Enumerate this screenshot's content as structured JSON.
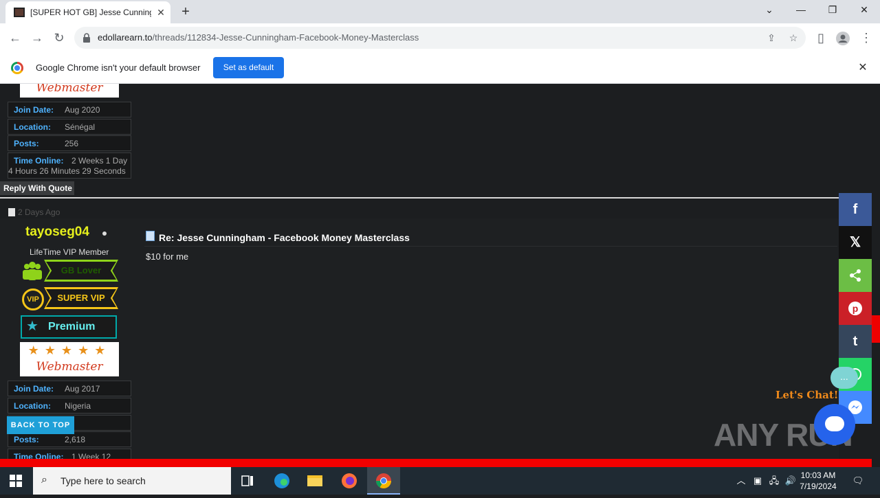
{
  "browser": {
    "tab_title": "[SUPER HOT GB] Jesse Cunningham - Facebook Money Masterclass",
    "url_host": "edollarearn.to",
    "url_path": "/threads/112834-Jesse-Cunningham-Facebook-Money-Masterclass",
    "infobar_text": "Google Chrome isn't your default browser",
    "set_default_label": "Set as default"
  },
  "prev_post": {
    "badge_text": "Webmaster",
    "join_date_label": "Join Date:",
    "join_date": "Aug 2020",
    "location_label": "Location:",
    "location": "Sénégal",
    "posts_label": "Posts:",
    "posts": "256",
    "time_online_label": "Time Online:",
    "time_online_1": "2 Weeks 1 Day",
    "time_online_2": "4 Hours 26 Minutes 29 Seconds",
    "reply_label": "Reply With Quote"
  },
  "post": {
    "date": "2 Days Ago",
    "username": "tayoseg04",
    "user_title": "LifeTime VIP Member",
    "badge_gb": "GB Lover",
    "badge_vip": "SUPER VIP",
    "badge_vip_icon": "VIP",
    "badge_premium": "Premium",
    "badge_webmaster": "Webmaster",
    "badge_stars": "★★★★★",
    "join_date_label": "Join Date:",
    "join_date": "Aug 2017",
    "location_label": "Location:",
    "location": "Nigeria",
    "posts_label": "Posts:",
    "posts": "2,618",
    "time_online_label": "Time Online:",
    "time_online": "1 Week 12",
    "title": "Re: Jesse Cunningham - Facebook Money Masterclass",
    "body": "$10 for me"
  },
  "page": {
    "back_to_top": "BACK TO TOP",
    "lets_chat": "Let's Chat!",
    "chat_dots": "...",
    "watermark": "ANY RUN"
  },
  "share": {
    "facebook": "f",
    "x": "𝕏",
    "tumblr": "t"
  },
  "taskbar": {
    "search_placeholder": "Type here to search",
    "time": "10:03 AM",
    "date": "7/19/2024"
  },
  "colors": {
    "facebook": "#3b5998",
    "x": "#111111",
    "share": "#6cbe45",
    "pinterest": "#cb2027",
    "tumblr": "#35465c",
    "whatsapp": "#25d366",
    "messenger": "#448aff"
  }
}
